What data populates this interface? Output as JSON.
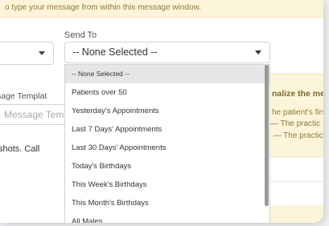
{
  "banner": {
    "text": "o type your message from within this message window."
  },
  "send_to": {
    "label": "Send To",
    "selected": "-- None Selected --",
    "options": [
      "-- None Selected --",
      "Patients over 50",
      "Yesterday's Appointments",
      "Last 7 Days' Appointments",
      "Last 30 Days' Appointments",
      "Today's Birthdays",
      "This Week's Birthdays",
      "This Month's Birthdays",
      "All Males"
    ]
  },
  "template": {
    "label": "sage Templat",
    "placeholder": "Message Tem"
  },
  "body_text": "shots. Call",
  "personalize": {
    "title": "nalize the me",
    "line1": "he patient's firs",
    "line2": "— The practic",
    "line3": "] — The practic"
  }
}
